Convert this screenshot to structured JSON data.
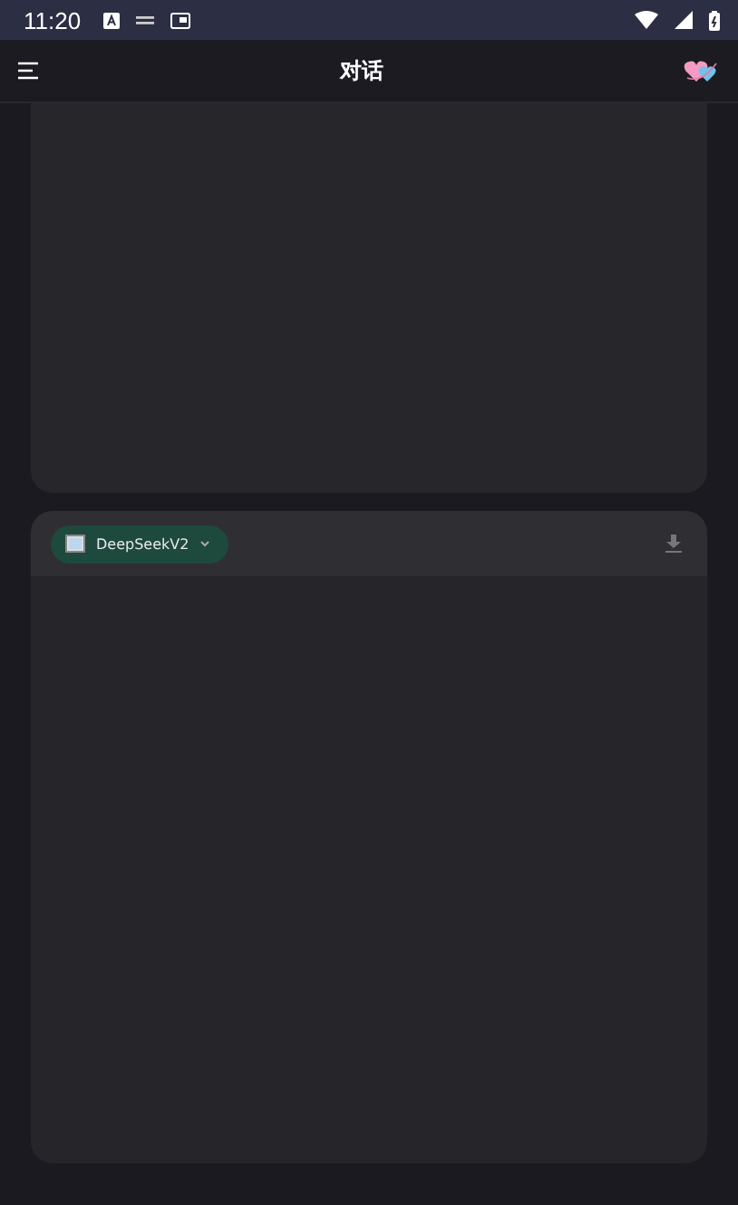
{
  "status_bar": {
    "time": "11:20"
  },
  "app_bar": {
    "title": "对话"
  },
  "panels": [
    {
      "kind": "empty"
    },
    {
      "kind": "model",
      "model": {
        "name": "DeepSeekV2"
      }
    }
  ]
}
